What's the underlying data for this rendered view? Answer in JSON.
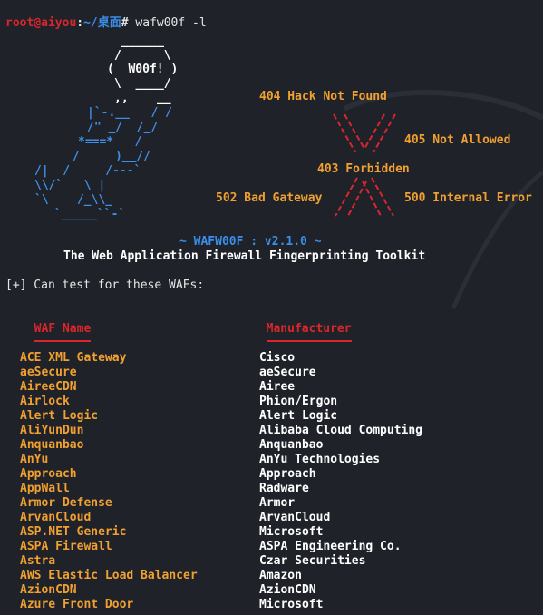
{
  "prompt": {
    "user": "root@aiyou",
    "sep": ":",
    "path": "~/桌面",
    "symbol": "#",
    "command": " wafw00f -l"
  },
  "logo": {
    "line1": "______",
    "line2": "/      \\",
    "line3": "(  W00f! )",
    "line4": "\\  ____/",
    "line5": ",,    __",
    "dog": [
      "|`-.__   / /",
      "/\" _/  /_/",
      "*===*   /",
      "/     )__//",
      "/|  /     /---`",
      "\\\\/`   \\ |",
      "`\\    /_\\\\_",
      "`_____``-`"
    ]
  },
  "errors": {
    "e404": "404 Hack Not Found",
    "e405": "405 Not Allowed",
    "e403": "403 Forbidden",
    "e502": "502 Bad Gateway",
    "e500": "500 Internal Error"
  },
  "banner": {
    "version": "~ WAFW00F : v2.1.0 ~",
    "tagline": "The Web Application Firewall Fingerprinting Toolkit"
  },
  "intro": "[+] Can test for these WAFs:",
  "table": {
    "col1": "WAF Name",
    "col2": "Manufacturer",
    "rows": [
      {
        "name": "ACE XML Gateway",
        "maker": "Cisco"
      },
      {
        "name": "aeSecure",
        "maker": "aeSecure"
      },
      {
        "name": "AireeCDN",
        "maker": "Airee"
      },
      {
        "name": "Airlock",
        "maker": "Phion/Ergon"
      },
      {
        "name": "Alert Logic",
        "maker": "Alert Logic"
      },
      {
        "name": "AliYunDun",
        "maker": "Alibaba Cloud Computing"
      },
      {
        "name": "Anquanbao",
        "maker": "Anquanbao"
      },
      {
        "name": "AnYu",
        "maker": "AnYu Technologies"
      },
      {
        "name": "Approach",
        "maker": "Approach"
      },
      {
        "name": "AppWall",
        "maker": "Radware"
      },
      {
        "name": "Armor Defense",
        "maker": "Armor"
      },
      {
        "name": "ArvanCloud",
        "maker": "ArvanCloud"
      },
      {
        "name": "ASP.NET Generic",
        "maker": "Microsoft"
      },
      {
        "name": "ASPA Firewall",
        "maker": "ASPA Engineering Co."
      },
      {
        "name": "Astra",
        "maker": "Czar Securities"
      },
      {
        "name": "AWS Elastic Load Balancer",
        "maker": "Amazon"
      },
      {
        "name": "AzionCDN",
        "maker": "AzionCDN"
      },
      {
        "name": "Azure Front Door",
        "maker": "Microsoft"
      }
    ]
  },
  "colors": {
    "background": "#1f2229",
    "prompt_user": "#d9262c",
    "prompt_path": "#3b8eea",
    "error_text": "#f0a030",
    "waf_name": "#f0a030",
    "header": "#d9262c",
    "dog": "#3f8fe8",
    "logo": "#ffffff"
  }
}
